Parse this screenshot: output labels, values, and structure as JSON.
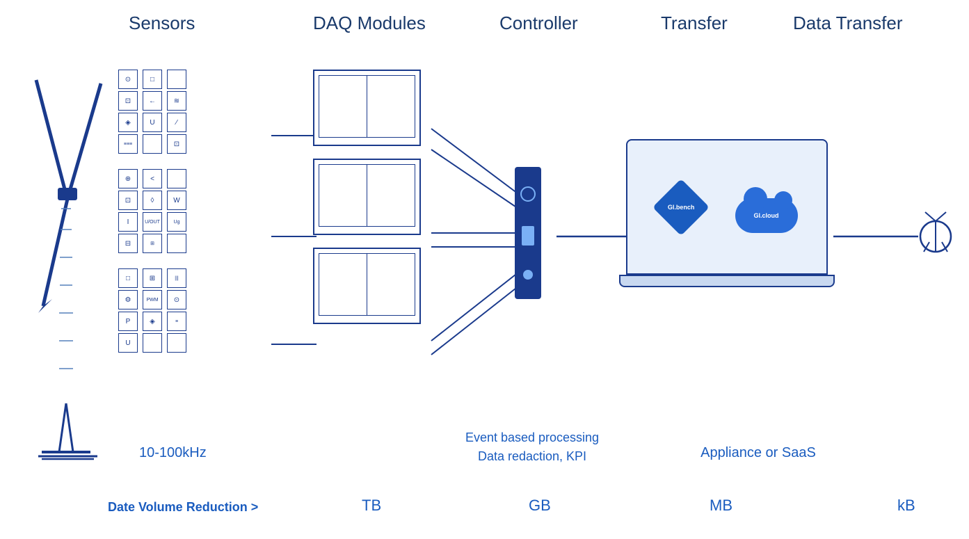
{
  "headers": {
    "sensors": "Sensors",
    "daq": "DAQ Modules",
    "controller": "Controller",
    "transfer": "Transfer",
    "dataTransfer": "Data Transfer"
  },
  "labels": {
    "frequency": "10-100kHz",
    "eventBased": "Event based processing",
    "dataRedaction": "Data redaction, KPI",
    "applianceOrSaaS": "Appliance or SaaS",
    "dataVolumeReduction": "Date Volume Reduction >",
    "tb": "TB",
    "gb": "GB",
    "mb": "MB",
    "kb": "kB"
  },
  "logos": {
    "bench": "Gl.bench",
    "cloud": "Gl.cloud"
  },
  "colors": {
    "primary": "#1a3a8c",
    "accent": "#1a5cbf",
    "light": "#7ab0f5",
    "bg": "#ffffff"
  },
  "sensorIcons": [
    [
      "⊙",
      "□",
      "",
      ""
    ],
    [
      "⊡",
      "←",
      "≋",
      ""
    ],
    [
      "◈",
      "U",
      "∕",
      "≡"
    ],
    [
      "≈",
      "",
      "",
      "⊡"
    ],
    [
      "⊕",
      "<",
      "",
      ""
    ],
    [
      "⊡",
      "◊",
      "W",
      "I"
    ],
    [
      "◈",
      "⊗",
      "",
      "Ug"
    ],
    [
      "⊟",
      "U/OUT",
      "",
      ""
    ],
    [
      "⊞",
      "⊡",
      "",
      ""
    ],
    [
      "□",
      "⊞",
      "|||",
      ""
    ],
    [
      "⚙",
      "PWM",
      "⊙",
      ""
    ],
    [
      "P",
      "◈",
      "≡",
      "U"
    ]
  ]
}
